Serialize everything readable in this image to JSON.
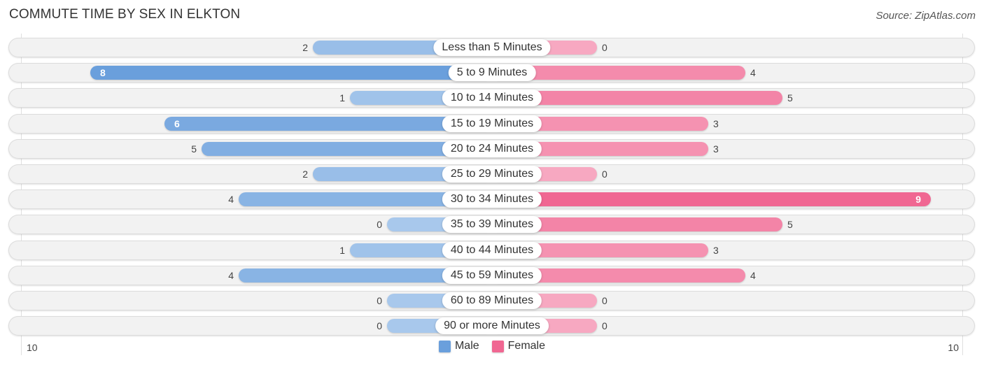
{
  "chart_data": {
    "type": "bar",
    "orientation": "horizontal-diverging",
    "title": "COMMUTE TIME BY SEX IN ELKTON",
    "source": "Source: ZipAtlas.com",
    "categories": [
      "Less than 5 Minutes",
      "5 to 9 Minutes",
      "10 to 14 Minutes",
      "15 to 19 Minutes",
      "20 to 24 Minutes",
      "25 to 29 Minutes",
      "30 to 34 Minutes",
      "35 to 39 Minutes",
      "40 to 44 Minutes",
      "45 to 59 Minutes",
      "60 to 89 Minutes",
      "90 or more Minutes"
    ],
    "series": [
      {
        "name": "Male",
        "color": "#6a9fdc",
        "color_light": "#a8c8ec",
        "values": [
          2,
          8,
          1,
          6,
          5,
          2,
          4,
          0,
          1,
          4,
          0,
          0
        ]
      },
      {
        "name": "Female",
        "color": "#f06792",
        "color_light": "#f7a8c1",
        "values": [
          0,
          4,
          5,
          3,
          3,
          0,
          9,
          5,
          3,
          4,
          0,
          0
        ]
      }
    ],
    "axis": {
      "left_label": "10",
      "right_label": "10",
      "max": 10
    },
    "legend": {
      "position": "bottom-center",
      "items": [
        "Male",
        "Female"
      ]
    },
    "grid": false
  }
}
